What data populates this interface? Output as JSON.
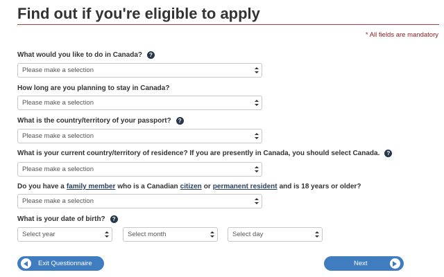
{
  "header": {
    "title": "Find out if you're eligible to apply",
    "mandatory_note": "* All fields are mandatory"
  },
  "questions": {
    "q1": {
      "label": "What would you like to do in Canada?",
      "value": "Please make a selection"
    },
    "q2": {
      "label": "How long are you planning to stay in Canada?",
      "value": "Please make a selection"
    },
    "q3": {
      "label": "What is the country/territory of your passport?",
      "value": "Please make a selection"
    },
    "q4": {
      "label": "What is your current country/territory of residence? If you are presently in Canada, you should select Canada.",
      "value": "Please make a selection"
    },
    "q5": {
      "prefix": "Do you have a",
      "link1": "family member",
      "mid1": "who is a Canadian",
      "link2": "citizen",
      "mid2": "or",
      "link3": "permanent resident",
      "suffix": "and is 18 years or older?",
      "value": "Please make a selection"
    },
    "q6": {
      "label": "What is your date of birth?",
      "year": "Select year",
      "month": "Select month",
      "day": "Select day"
    }
  },
  "buttons": {
    "exit": "Exit Questionnaire",
    "next": "Next"
  },
  "colors": {
    "accent_rule": "#af3c43",
    "button_blue": "#3f7dc0",
    "help_icon": "#26374a"
  }
}
